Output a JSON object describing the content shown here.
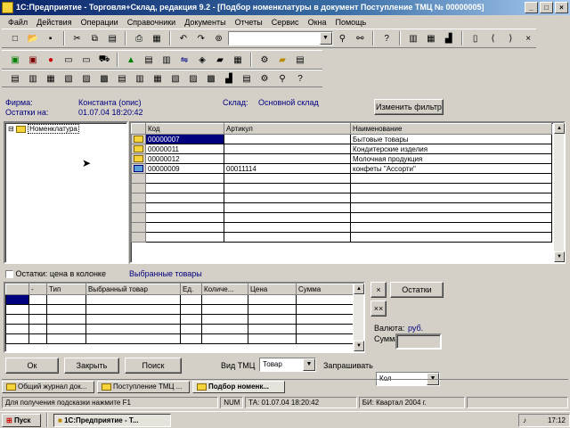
{
  "window": {
    "title": "1С:Предприятие - Торговля+Склад, редакция 9.2 - [Подбор номенклатуры в документ Поступление ТМЦ № 00000005]",
    "min": "_",
    "max": "□",
    "close": "×"
  },
  "menu": [
    "Файл",
    "Действия",
    "Операции",
    "Справочники",
    "Документы",
    "Отчеты",
    "Сервис",
    "Окна",
    "Помощь"
  ],
  "filters": {
    "firm_label": "Фирма:",
    "firm_value": "Константа (опис)",
    "rest_label": "Остатки на:",
    "rest_value": "01.07.04 18:20:42",
    "warehouse_label": "Склад:",
    "warehouse_value": "Основной склад",
    "change_filter_btn": "Изменить фильтр"
  },
  "tree": {
    "root": "Номенклатура"
  },
  "catalog_table": {
    "headers": [
      "Код",
      "Артикул",
      "Наименование"
    ],
    "rows": [
      {
        "code": "00000007",
        "article": "",
        "name": "Бытовые товары"
      },
      {
        "code": "00000011",
        "article": "",
        "name": "Кондитерские изделия"
      },
      {
        "code": "00000012",
        "article": "",
        "name": "Молочная продукция"
      },
      {
        "code": "00000009",
        "article": "00011114",
        "name": "конфеты \"Ассорти\""
      }
    ]
  },
  "options": {
    "show_rest_label": "Остатки: цена в колонке",
    "selected_goods_label": "Выбранные товары"
  },
  "selected_table": {
    "headers": [
      "",
      "-",
      "Тип",
      "Выбранный товар",
      "Ед.",
      "Количе...",
      "Цена",
      "Сумма"
    ]
  },
  "side": {
    "x_btn": "×",
    "rest_btn": "Остатки",
    "xx_btn": "××",
    "currency_label": "Валюта:",
    "currency_value": "руб.",
    "sum_label": "Сумма"
  },
  "bottom": {
    "ok": "Ок",
    "close": "Закрыть",
    "search": "Поиск",
    "type_label": "Вид ТМЦ",
    "type_value": "Товар",
    "request_label": "Запрашивать",
    "request_value": "Кол"
  },
  "doc_tabs": [
    "Общий журнал док...",
    "Поступление ТМЦ ...",
    "Подбор номенк..."
  ],
  "status": {
    "hint": "Для получения подсказки нажмите F1",
    "cap": "NUM",
    "date": "ТА: 01.07.04 18:20:42",
    "period": "БИ: Квартал 2004 г."
  },
  "taskbar": {
    "start": "Пуск",
    "task": "1С:Предприятие - Т...",
    "clock": "17:12"
  }
}
